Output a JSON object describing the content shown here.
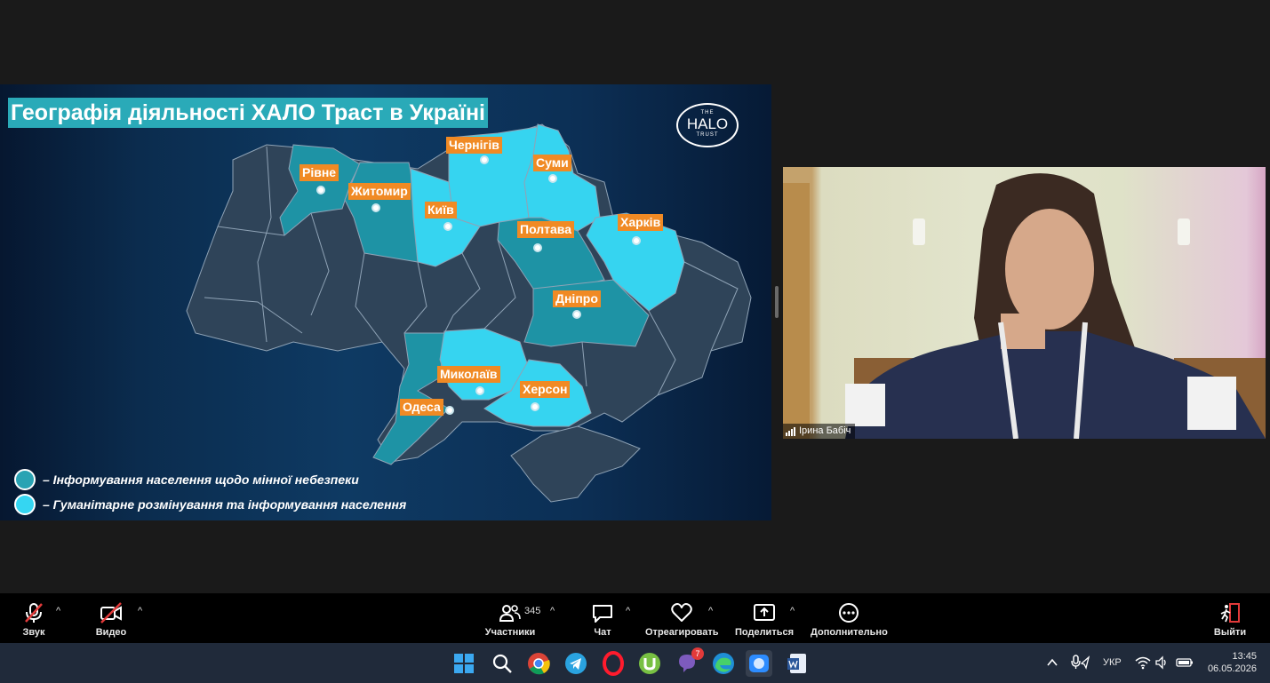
{
  "slide": {
    "title": "Географія діяльності ХАЛО Траст в Україні",
    "logo": {
      "the": "THE",
      "halo": "HALO",
      "trust": "TRUST"
    },
    "cities": [
      "Рівне",
      "Житомир",
      "Київ",
      "Чернігів",
      "Суми",
      "Полтава",
      "Харків",
      "Дніпро",
      "Миколаїв",
      "Херсон",
      "Одеса"
    ],
    "legend": [
      {
        "text": "– Інформування населення щодо мінної небезпеки",
        "color": "#2aa3b3"
      },
      {
        "text": "– Гуманітарне розмінування та інформування населення",
        "color": "#35d6f2"
      }
    ],
    "colors": {
      "dark_region": "#2f4459",
      "teal_region": "#1e93a5",
      "cyan_region": "#36d4f0",
      "label_bg": "#f08a24"
    }
  },
  "video": {
    "participant_name": "Ірина Бабіч"
  },
  "toolbar": {
    "audio": "Звук",
    "video": "Видео",
    "participants": "Участники",
    "participants_count": "345",
    "chat": "Чат",
    "react": "Отреагировать",
    "share": "Поделиться",
    "more": "Дополнительно",
    "leave": "Выйти"
  },
  "taskbar": {
    "apps": [
      "windows-start",
      "search",
      "chrome",
      "telegram",
      "opera",
      "utorrent",
      "viber",
      "edge",
      "zoom",
      "word"
    ],
    "viber_badge": "7",
    "language": "УКР",
    "time": "13:45",
    "date": "06.05.2026"
  }
}
